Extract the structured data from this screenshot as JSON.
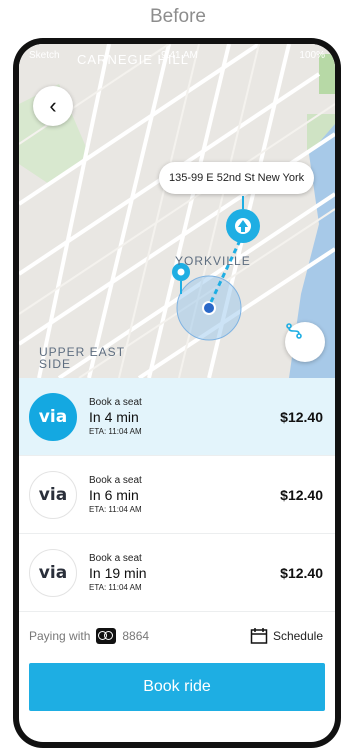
{
  "caption": "Before",
  "status_bar": {
    "carrier": "Sketch",
    "time": "9:41 AM",
    "battery": "100%"
  },
  "map": {
    "neighborhood_top": "CARNEGIE HILL",
    "neighborhood_mid": "YORKVILLE",
    "neighborhood_bottom": "UPPER EAST SIDE",
    "destination_address": "135-99 E 52nd St New York",
    "back_icon": "chevron-left",
    "route_icon": "route-icon"
  },
  "rides": [
    {
      "title": "Book a seat",
      "time": "In 4 min",
      "eta": "ETA: 11:04 AM",
      "price": "$12.40",
      "logo": "via",
      "selected": true
    },
    {
      "title": "Book a seat",
      "time": "In 6 min",
      "eta": "ETA: 11:04 AM",
      "price": "$12.40",
      "logo": "via",
      "selected": false
    },
    {
      "title": "Book a seat",
      "time": "In 19 min",
      "eta": "ETA: 11:04 AM",
      "price": "$12.40",
      "logo": "via",
      "selected": false
    }
  ],
  "payment": {
    "label": "Paying with",
    "card_number": "8864",
    "schedule_label": "Schedule"
  },
  "book_button": "Book ride",
  "colors": {
    "accent": "#1eaee3",
    "selected_row": "#e3f4fb"
  }
}
